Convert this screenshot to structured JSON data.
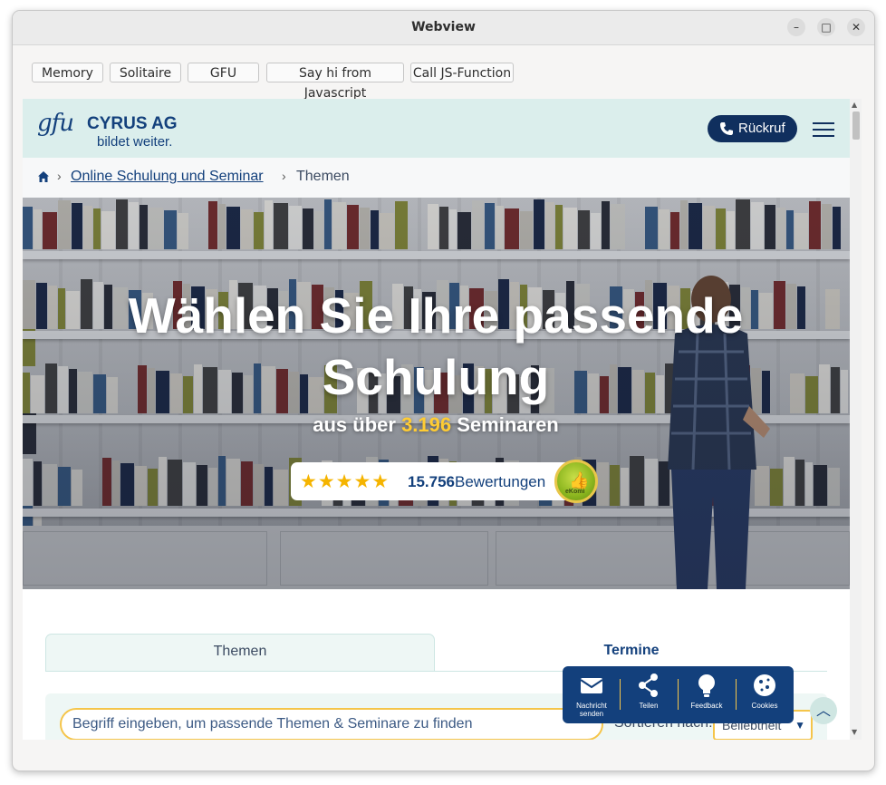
{
  "window": {
    "title": "Webview",
    "controls": [
      "minimize-icon",
      "maximize-icon",
      "close-icon"
    ]
  },
  "app_toolbar": {
    "buttons": [
      "Memory",
      "Solitaire",
      "GFU",
      "Say hi from Javascript",
      "Call JS-Function"
    ]
  },
  "site": {
    "logo_mark": "gfu",
    "logo_name": "CYRUS AG",
    "logo_tagline": "bildet weiter.",
    "callback_button": "Rückruf",
    "menu_icon": "hamburger-menu-icon"
  },
  "breadcrumb": {
    "home_icon": "home-icon",
    "separator": "›",
    "link": "Online Schulung und Seminar",
    "current": "Themen"
  },
  "hero": {
    "title": "Wählen Sie Ihre passende Schulung",
    "subtitle_prefix": "aus über",
    "seminar_count": "3.196",
    "subtitle_suffix": "Seminaren",
    "stars": "★★★★★",
    "star_rating": 5,
    "review_count": "15.756",
    "review_label": "Bewertungen",
    "badge_icon": "ekomi-seal-icon",
    "badge_text": "eKomi"
  },
  "tabs": {
    "items": [
      "Themen",
      "Termine"
    ],
    "active": "Themen"
  },
  "search": {
    "placeholder": "Begriff eingeben, um passende Themen & Seminare zu finden",
    "sort_label": "Sortieren nach:",
    "sort_value": "Beliebtheit"
  },
  "floating_toolbar": {
    "items": [
      {
        "label_line1": "Nachricht",
        "label_line2": "senden",
        "icon": "mail-icon"
      },
      {
        "label_line1": "Teilen",
        "label_line2": "",
        "icon": "share-icon"
      },
      {
        "label_line1": "Feedback",
        "label_line2": "",
        "icon": "lightbulb-icon"
      },
      {
        "label_line1": "Cookies",
        "label_line2": "",
        "icon": "cookie-icon"
      }
    ],
    "scroll_top_icon": "chevron-up-icon"
  },
  "colors": {
    "brand_navy": "#13407c",
    "header_mint": "#dbeeec",
    "accent_yellow": "#f5c54a",
    "star_gold": "#f5b400"
  }
}
